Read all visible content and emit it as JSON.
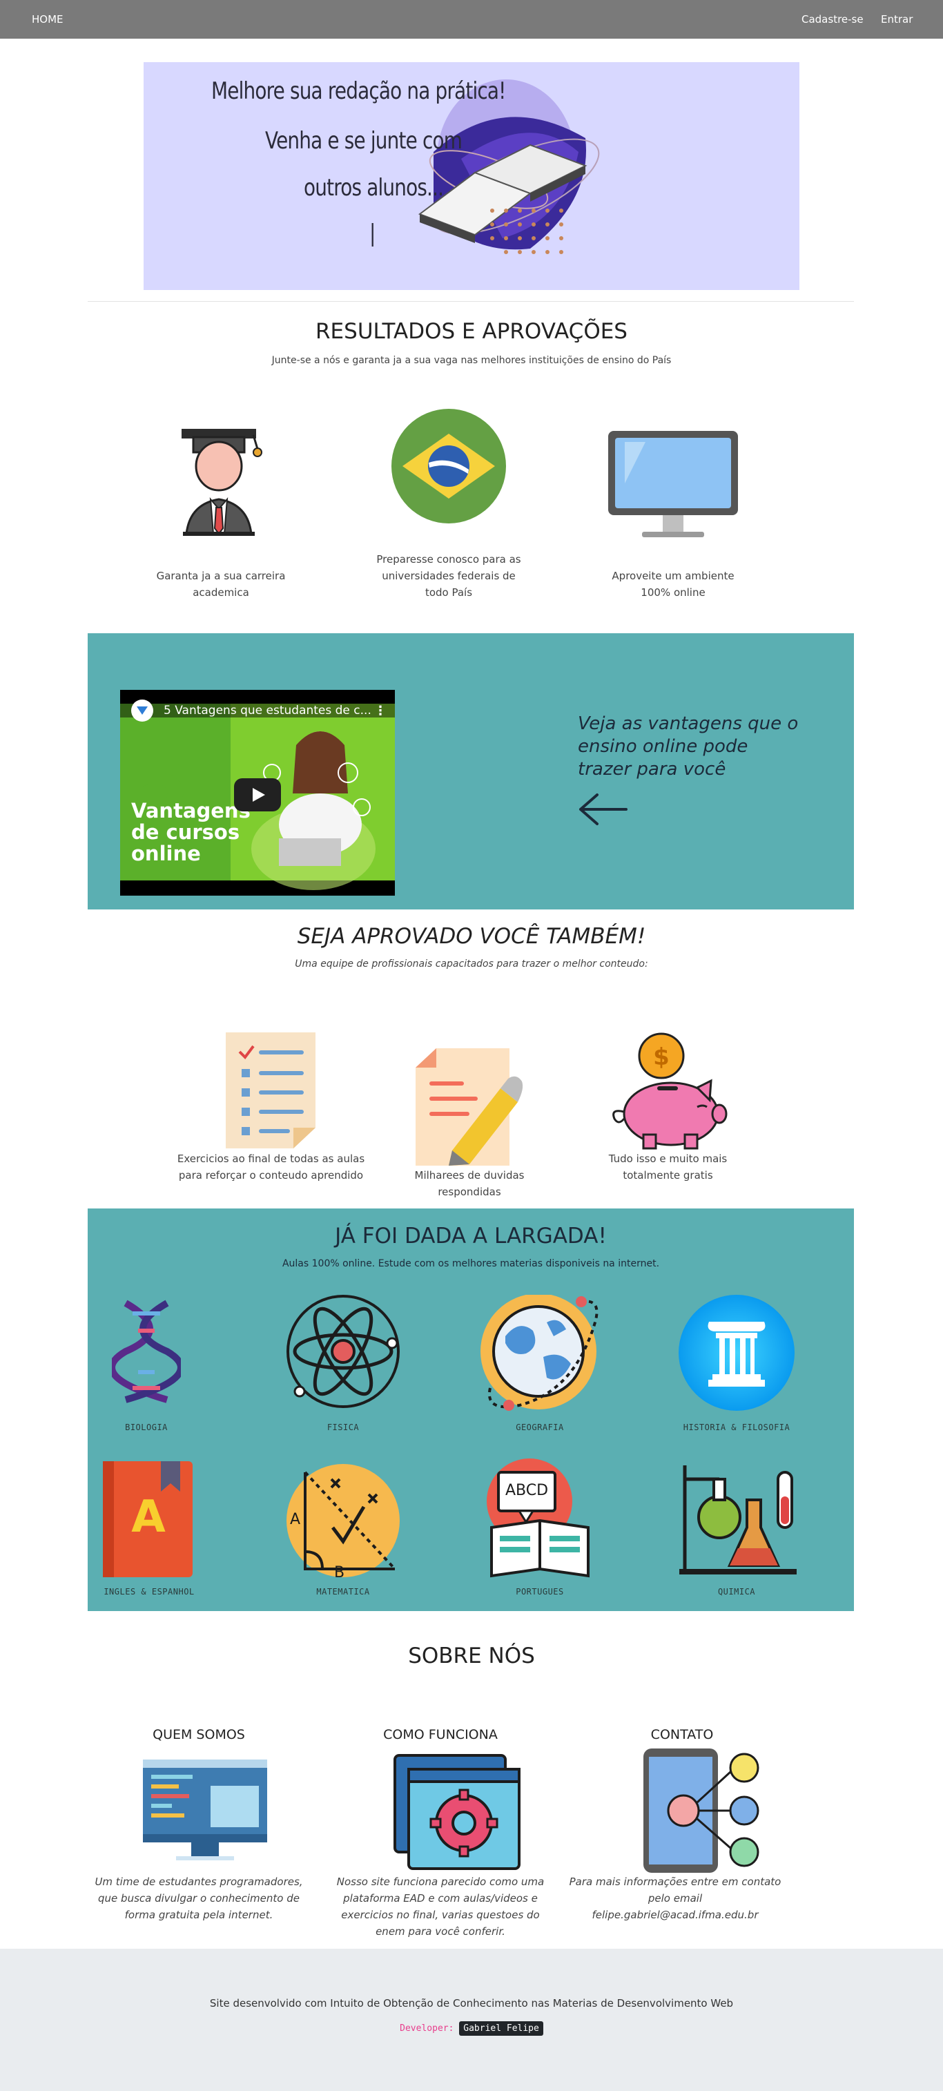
{
  "nav": {
    "home": "HOME",
    "signup": "Cadastre-se",
    "login": "Entrar"
  },
  "hero": {
    "line1": "Melhore sua redação na prática!",
    "line2": "Venha e se junte com",
    "line3": "outros alunos...",
    "cursor": "|"
  },
  "results": {
    "title": "RESULTADOS E APROVAÇÕES",
    "subtitle": "Junte-se a nós e garanta ja a sua vaga nas melhores instituições de ensino do País",
    "items": [
      {
        "icon": "graduate-icon",
        "text": "Garanta ja a sua carreira academica"
      },
      {
        "icon": "brazil-flag-icon",
        "text": "Preparesse conosco para as universidades federais de todo País"
      },
      {
        "icon": "monitor-icon",
        "text": "Aproveite um ambiente 100% online"
      }
    ]
  },
  "video": {
    "title": "5 Vantagens que estudantes de c...",
    "thumb_line1": "Vantagens",
    "thumb_line2": "de cursos",
    "thumb_line3": "online",
    "thumb_number": "5",
    "promo_text": "Veja as vantagens que o ensino online pode trazer para você"
  },
  "approved": {
    "title": "SEJA APROVADO VOCÊ TAMBÉM!",
    "subtitle": "Uma equipe de profissionais capacitados para trazer o melhor conteudo:",
    "items": [
      {
        "icon": "checklist-icon",
        "text": "Exercicios ao final de todas as aulas para reforçar o conteudo aprendido"
      },
      {
        "icon": "document-pencil-icon",
        "text": "Milharees de duvidas respondidas"
      },
      {
        "icon": "piggy-bank-icon",
        "text": "Tudo isso e muito mais totalmente gratis"
      }
    ]
  },
  "subjects": {
    "title": "JÁ FOI DADA A LARGADA!",
    "subtitle": "Aulas 100% online. Estude com os melhores materias disponiveis na internet.",
    "items": [
      {
        "icon": "dna-icon",
        "label": "BIOLOGIA"
      },
      {
        "icon": "atom-icon",
        "label": "FISICA"
      },
      {
        "icon": "globe-icon",
        "label": "GEOGRAFIA"
      },
      {
        "icon": "column-icon",
        "label": "HISTORIA & FILOSOFIA"
      },
      {
        "icon": "dictionary-icon",
        "label": "INGLES & ESPANHOL",
        "glyph": "A"
      },
      {
        "icon": "geometry-icon",
        "label": "MATEMATICA"
      },
      {
        "icon": "abcd-book-icon",
        "label": "PORTUGUES",
        "glyph": "ABCD"
      },
      {
        "icon": "flask-icon",
        "label": "QUIMICA"
      }
    ]
  },
  "about": {
    "title": "SOBRE NÓS",
    "cols": [
      {
        "heading": "QUEM SOMOS",
        "icon": "code-monitor-icon",
        "text": "Um time de estudantes programadores, que busca divulgar o conhecimento de forma gratuita pela internet."
      },
      {
        "heading": "COMO FUNCIONA",
        "icon": "gear-window-icon",
        "text": "Nosso site funciona parecido como uma plataforma EAD e com aulas/videos e exercicios no final, varias questoes do enem para você conferir."
      },
      {
        "heading": "CONTATO",
        "icon": "network-phone-icon",
        "text": "Para mais informações entre em contato pelo email felipe.gabriel@acad.ifma.edu.br"
      }
    ]
  },
  "footer": {
    "text": "Site desenvolvido com Intuito de Obtenção de Conhecimento nas Materias de Desenvolvimento Web",
    "dev_label": "Developer:",
    "dev_name": "Gabriel Felipe"
  },
  "colors": {
    "navbar": "#7a7a7a",
    "teal": "#5bafb2",
    "hero_bg": "#d8d8ff",
    "footer_bg": "#e9ecef"
  }
}
